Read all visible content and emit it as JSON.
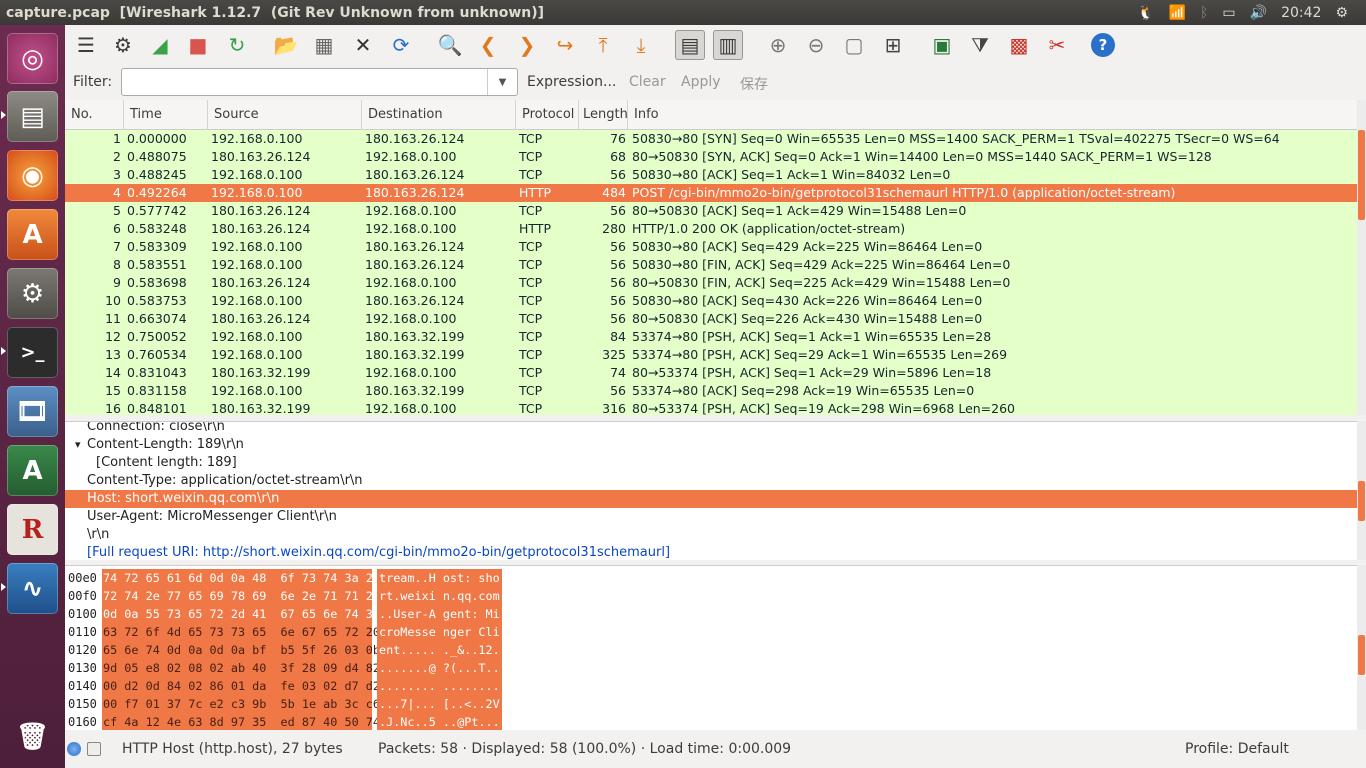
{
  "window": {
    "title": "capture.pcap  [Wireshark 1.12.7  (Git Rev Unknown from unknown)]"
  },
  "tray": {
    "clock": "20:42"
  },
  "launcher": {
    "items": [
      "ubuntu-dash-icon",
      "file-manager-icon",
      "firefox-icon",
      "software-center-icon",
      "system-settings-icon",
      "terminal-icon",
      "video-editor-icon",
      "software-updater-icon",
      "text-editor-icon",
      "wireshark-icon",
      "trash-icon"
    ]
  },
  "toolbar": {
    "icons": [
      "list-interfaces-icon",
      "capture-options-icon",
      "start-capture-icon",
      "stop-capture-icon",
      "restart-capture-icon",
      "open-file-icon",
      "save-file-icon",
      "close-file-icon",
      "reload-icon",
      "find-packet-icon",
      "go-back-icon",
      "go-forward-icon",
      "go-to-packet-icon",
      "go-first-icon",
      "go-last-icon",
      "colorize-icon",
      "auto-scroll-icon",
      "zoom-in-icon",
      "zoom-out-icon",
      "normal-size-icon",
      "resize-columns-icon",
      "capture-filters-icon",
      "display-filters-icon",
      "coloring-rules-icon",
      "preferences-icon",
      "help-icon"
    ]
  },
  "filter": {
    "label": "Filter:",
    "value": "",
    "expression": "Expression...",
    "clear": "Clear",
    "apply": "Apply",
    "save": "保存"
  },
  "columns": [
    "No.",
    "Time",
    "Source",
    "Destination",
    "Protocol",
    "Length",
    "Info"
  ],
  "packets": [
    {
      "no": "1",
      "time": "0.000000",
      "src": "192.168.0.100",
      "dst": "180.163.26.124",
      "proto": "TCP",
      "len": "76",
      "info": "50830→80 [SYN] Seq=0 Win=65535 Len=0 MSS=1400 SACK_PERM=1 TSval=402275 TSecr=0 WS=64"
    },
    {
      "no": "2",
      "time": "0.488075",
      "src": "180.163.26.124",
      "dst": "192.168.0.100",
      "proto": "TCP",
      "len": "68",
      "info": "80→50830 [SYN, ACK] Seq=0 Ack=1 Win=14400 Len=0 MSS=1440 SACK_PERM=1 WS=128"
    },
    {
      "no": "3",
      "time": "0.488245",
      "src": "192.168.0.100",
      "dst": "180.163.26.124",
      "proto": "TCP",
      "len": "56",
      "info": "50830→80 [ACK] Seq=1 Ack=1 Win=84032 Len=0"
    },
    {
      "no": "4",
      "time": "0.492264",
      "src": "192.168.0.100",
      "dst": "180.163.26.124",
      "proto": "HTTP",
      "len": "484",
      "info": "POST /cgi-bin/mmo2o-bin/getprotocol31schemaurl HTTP/1.0  (application/octet-stream)",
      "selected": true
    },
    {
      "no": "5",
      "time": "0.577742",
      "src": "180.163.26.124",
      "dst": "192.168.0.100",
      "proto": "TCP",
      "len": "56",
      "info": "80→50830 [ACK] Seq=1 Ack=429 Win=15488 Len=0"
    },
    {
      "no": "6",
      "time": "0.583248",
      "src": "180.163.26.124",
      "dst": "192.168.0.100",
      "proto": "HTTP",
      "len": "280",
      "info": "HTTP/1.0 200 OK  (application/octet-stream)"
    },
    {
      "no": "7",
      "time": "0.583309",
      "src": "192.168.0.100",
      "dst": "180.163.26.124",
      "proto": "TCP",
      "len": "56",
      "info": "50830→80 [ACK] Seq=429 Ack=225 Win=86464 Len=0"
    },
    {
      "no": "8",
      "time": "0.583551",
      "src": "192.168.0.100",
      "dst": "180.163.26.124",
      "proto": "TCP",
      "len": "56",
      "info": "50830→80 [FIN, ACK] Seq=429 Ack=225 Win=86464 Len=0"
    },
    {
      "no": "9",
      "time": "0.583698",
      "src": "180.163.26.124",
      "dst": "192.168.0.100",
      "proto": "TCP",
      "len": "56",
      "info": "80→50830 [FIN, ACK] Seq=225 Ack=429 Win=15488 Len=0"
    },
    {
      "no": "10",
      "time": "0.583753",
      "src": "192.168.0.100",
      "dst": "180.163.26.124",
      "proto": "TCP",
      "len": "56",
      "info": "50830→80 [ACK] Seq=430 Ack=226 Win=86464 Len=0"
    },
    {
      "no": "11",
      "time": "0.663074",
      "src": "180.163.26.124",
      "dst": "192.168.0.100",
      "proto": "TCP",
      "len": "56",
      "info": "80→50830 [ACK] Seq=226 Ack=430 Win=15488 Len=0"
    },
    {
      "no": "12",
      "time": "0.750052",
      "src": "192.168.0.100",
      "dst": "180.163.32.199",
      "proto": "TCP",
      "len": "84",
      "info": "53374→80 [PSH, ACK] Seq=1 Ack=1 Win=65535 Len=28"
    },
    {
      "no": "13",
      "time": "0.760534",
      "src": "192.168.0.100",
      "dst": "180.163.32.199",
      "proto": "TCP",
      "len": "325",
      "info": "53374→80 [PSH, ACK] Seq=29 Ack=1 Win=65535 Len=269"
    },
    {
      "no": "14",
      "time": "0.831043",
      "src": "180.163.32.199",
      "dst": "192.168.0.100",
      "proto": "TCP",
      "len": "74",
      "info": "80→53374 [PSH, ACK] Seq=1 Ack=29 Win=5896 Len=18"
    },
    {
      "no": "15",
      "time": "0.831158",
      "src": "192.168.0.100",
      "dst": "180.163.32.199",
      "proto": "TCP",
      "len": "56",
      "info": "53374→80 [ACK] Seq=298 Ack=19 Win=65535 Len=0"
    },
    {
      "no": "16",
      "time": "0.848101",
      "src": "180.163.32.199",
      "dst": "192.168.0.100",
      "proto": "TCP",
      "len": "316",
      "info": "80→53374 [PSH, ACK] Seq=19 Ack=298 Win=6968 Len=260"
    }
  ],
  "details": [
    {
      "text": "Connection: close\\r\\n",
      "indent": 1
    },
    {
      "text": "Content-Length: 189\\r\\n",
      "indent": 0,
      "expanded": true
    },
    {
      "text": "[Content length: 189]",
      "indent": 2
    },
    {
      "text": "Content-Type: application/octet-stream\\r\\n",
      "indent": 1
    },
    {
      "text": "Host: short.weixin.qq.com\\r\\n",
      "indent": 1,
      "selected": true
    },
    {
      "text": "User-Agent: MicroMessenger Client\\r\\n",
      "indent": 1
    },
    {
      "text": "\\r\\n",
      "indent": 1
    },
    {
      "text": "[Full request URI: http://short.weixin.qq.com/cgi-bin/mmo2o-bin/getprotocol31schemaurl]",
      "indent": 1,
      "link": true
    }
  ],
  "hex": [
    {
      "off": "00e0",
      "hex": "74 72 65 61 6d 0d 0a 48  6f 73 74 3a 20 73 68 6f",
      "ascii": "tream..H ost: sho",
      "whiteFrom": 7
    },
    {
      "off": "00f0",
      "hex": "72 74 2e 77 65 69 78 69  6e 2e 71 71 2e 63 6f 6d",
      "ascii": "rt.weixi n.qq.com",
      "whiteFrom": 0
    },
    {
      "off": "0100",
      "hex": "0d 0a 55 73 65 72 2d 41  67 65 6e 74 3a 20 4d 69",
      "ascii": "..User-A gent: Mi",
      "whiteFrom": -1,
      "whiteTo": 2
    },
    {
      "off": "0110",
      "hex": "63 72 6f 4d 65 73 73 65  6e 67 65 72 20 43 6c 69",
      "ascii": "croMesse nger Cli"
    },
    {
      "off": "0120",
      "hex": "65 6e 74 0d 0a 0d 0a bf  b5 5f 26 03 0b 31 32 e9",
      "ascii": "ent..... ._&..12."
    },
    {
      "off": "0130",
      "hex": "9d 05 e8 02 08 02 ab 40  3f 28 09 d4 82 54 c5 12",
      "ascii": ".......@ ?(...T.."
    },
    {
      "off": "0140",
      "hex": "00 d2 0d 84 02 86 01 da  fe 03 02 d7 d2 a8 f9 0d",
      "ascii": "........ ........"
    },
    {
      "off": "0150",
      "hex": "00 f7 01 37 7c e2 c3 9b  5b 1e ab 3c c6 fb 32 56",
      "ascii": "...7|... [..<..2V"
    },
    {
      "off": "0160",
      "hex": "cf 4a 12 4e 63 8d 97 35  ed 87 40 50 74 87 02 2e",
      "ascii": ".J.Nc..5 ..@Pt..."
    }
  ],
  "status": {
    "field": "HTTP Host (http.host), 27 bytes",
    "packets": "Packets: 58 · Displayed: 58 (100.0%)  · Load time: 0:00.009",
    "profile": "Profile: Default"
  },
  "colors": {
    "selection": "#f07746",
    "tcp_row": "#e4ffc7",
    "launcher": "#5c2546"
  }
}
